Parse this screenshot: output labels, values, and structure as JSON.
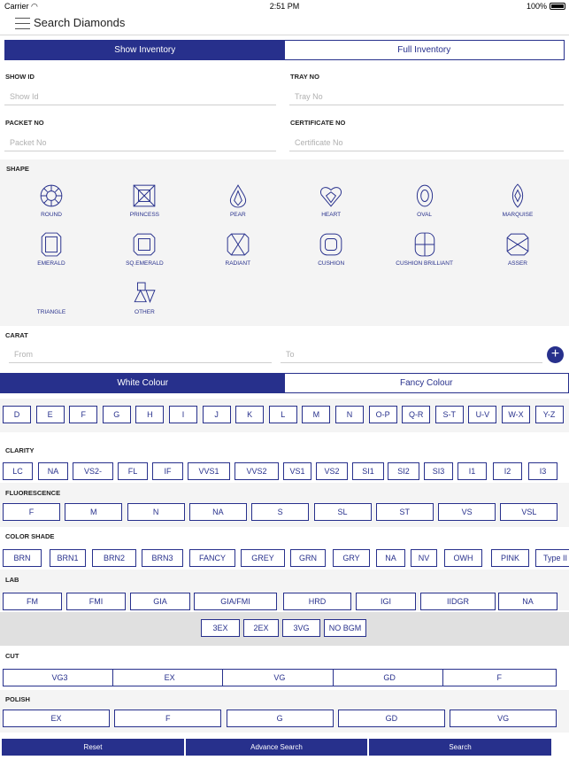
{
  "status_bar": {
    "carrier": "Carrier",
    "time": "2:51 PM",
    "battery": "100%"
  },
  "header": {
    "title": "Search Diamonds"
  },
  "inventory_tabs": {
    "show": "Show Inventory",
    "full": "Full Inventory"
  },
  "fields": {
    "show_id": {
      "label": "SHOW ID",
      "placeholder": "Show Id"
    },
    "tray_no": {
      "label": "TRAY NO",
      "placeholder": "Tray No"
    },
    "packet_no": {
      "label": "PACKET NO",
      "placeholder": "Packet No"
    },
    "certificate_no": {
      "label": "CERTIFICATE NO",
      "placeholder": "Certificate No"
    }
  },
  "shape": {
    "label": "SHAPE",
    "items": [
      "ROUND",
      "PRINCESS",
      "PEAR",
      "HEART",
      "OVAL",
      "MARQUISE",
      "EMERALD",
      "SQ.EMERALD",
      "RADIANT",
      "CUSHION",
      "CUSHION BRILLIANT",
      "ASSER",
      "TRIANGLE",
      "OTHER"
    ]
  },
  "carat": {
    "label": "CARAT",
    "from": "From",
    "to": "To",
    "add": "+"
  },
  "colour_tabs": {
    "white": "White Colour",
    "fancy": "Fancy Colour"
  },
  "colours": [
    "D",
    "E",
    "F",
    "G",
    "H",
    "I",
    "J",
    "K",
    "L",
    "M",
    "N",
    "O-P",
    "Q-R",
    "S-T",
    "U-V",
    "W-X",
    "Y-Z"
  ],
  "clarity": {
    "label": "CLARITY",
    "items": [
      "LC",
      "NA",
      "VS2-",
      "FL",
      "IF",
      "VVS1",
      "VVS2",
      "VS1",
      "VS2",
      "SI1",
      "SI2",
      "SI3",
      "I1",
      "I2",
      "I3"
    ]
  },
  "fluorescence": {
    "label": "FLUORESCENCE",
    "items": [
      "F",
      "M",
      "N",
      "NA",
      "S",
      "SL",
      "ST",
      "VS",
      "VSL"
    ]
  },
  "color_shade": {
    "label": "COLOR SHADE",
    "items": [
      "BRN",
      "BRN1",
      "BRN2",
      "BRN3",
      "FANCY",
      "GREY",
      "GRN",
      "GRY",
      "NA",
      "NV",
      "OWH",
      "PINK",
      "Type II"
    ]
  },
  "lab": {
    "label": "LAB",
    "items": [
      "FM",
      "FMI",
      "GIA",
      "GIA/FMI",
      "HRD",
      "IGI",
      "IIDGR",
      "NA"
    ]
  },
  "quick": [
    "3EX",
    "2EX",
    "3VG",
    "NO BGM"
  ],
  "cut": {
    "label": "CUT",
    "items": [
      "VG3",
      "EX",
      "VG",
      "GD",
      "F"
    ]
  },
  "polish": {
    "label": "POLISH",
    "items": [
      "EX",
      "F",
      "G",
      "GD",
      "VG"
    ]
  },
  "actions": {
    "reset": "Reset",
    "advance": "Advance Search",
    "search": "Search"
  },
  "colors": {
    "accent": "#27308c",
    "panel": "#f4f4f4"
  }
}
